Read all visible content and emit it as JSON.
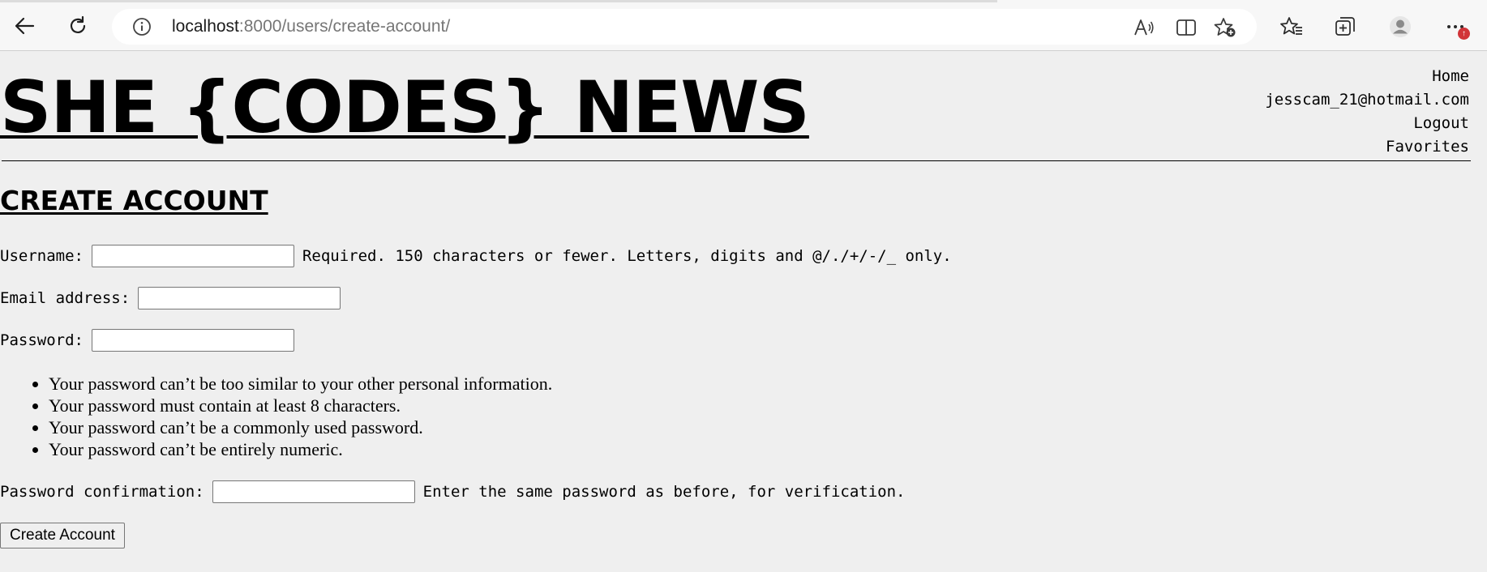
{
  "browser": {
    "url_host": "localhost",
    "url_path": ":8000/users/create-account/",
    "notification_badge": "↑"
  },
  "site": {
    "title": "SHE {CODES} NEWS"
  },
  "nav": {
    "home": "Home",
    "user_email": "jesscam_21@hotmail.com",
    "logout": "Logout",
    "favorites": "Favorites"
  },
  "page": {
    "heading": "CREATE ACCOUNT"
  },
  "form": {
    "username_label": "Username:",
    "username_value": "",
    "username_help": "Required. 150 characters or fewer. Letters, digits and @/./+/-/_ only.",
    "email_label": "Email address:",
    "email_value": "",
    "password_label": "Password:",
    "password_value": "",
    "password_rules": [
      "Your password can’t be too similar to your other personal information.",
      "Your password must contain at least 8 characters.",
      "Your password can’t be a commonly used password.",
      "Your password can’t be entirely numeric."
    ],
    "password_confirm_label": "Password confirmation:",
    "password_confirm_value": "",
    "password_confirm_help": "Enter the same password as before, for verification.",
    "submit_label": "Create Account"
  }
}
